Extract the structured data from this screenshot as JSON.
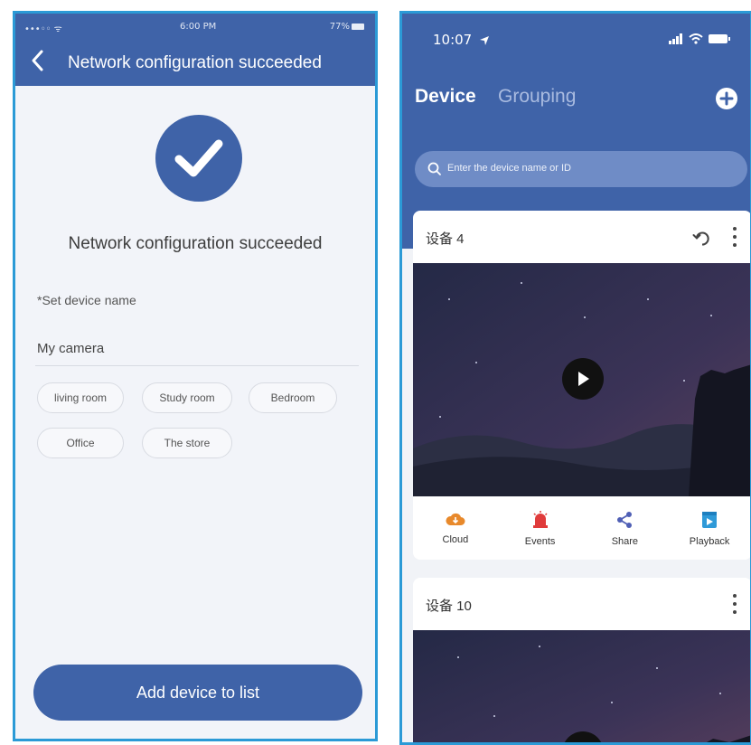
{
  "left_screen": {
    "status": {
      "carrier": "•••◦◦ ᯤ",
      "time": "6:00 PM",
      "battery": "77%"
    },
    "header": {
      "title": "Network configuration succeeded"
    },
    "success_message": "Network configuration succeeded",
    "device_name": {
      "label": "*Set device name",
      "value": "My camera"
    },
    "chips": [
      "living room",
      "Study room",
      "Bedroom",
      "Office",
      "The store"
    ],
    "add_button_label": "Add device to list"
  },
  "right_screen": {
    "status": {
      "time": "10:07"
    },
    "tabs": {
      "device": "Device",
      "grouping": "Grouping"
    },
    "search": {
      "placeholder": "Enter the device name or ID"
    },
    "cards": [
      {
        "title": "设备 4"
      },
      {
        "title": "设备 10"
      }
    ],
    "actions": [
      {
        "label": "Cloud",
        "icon": "cloud-icon",
        "color": "#e8892b"
      },
      {
        "label": "Events",
        "icon": "alarm-icon",
        "color": "#e03b3b"
      },
      {
        "label": "Share",
        "icon": "share-icon",
        "color": "#4f5fb5"
      },
      {
        "label": "Playback",
        "icon": "playback-icon",
        "color": "#2f9ad8"
      }
    ]
  },
  "colors": {
    "primary": "#3f63a8",
    "frame": "#2b9ad6",
    "background": "#f2f4f9"
  }
}
